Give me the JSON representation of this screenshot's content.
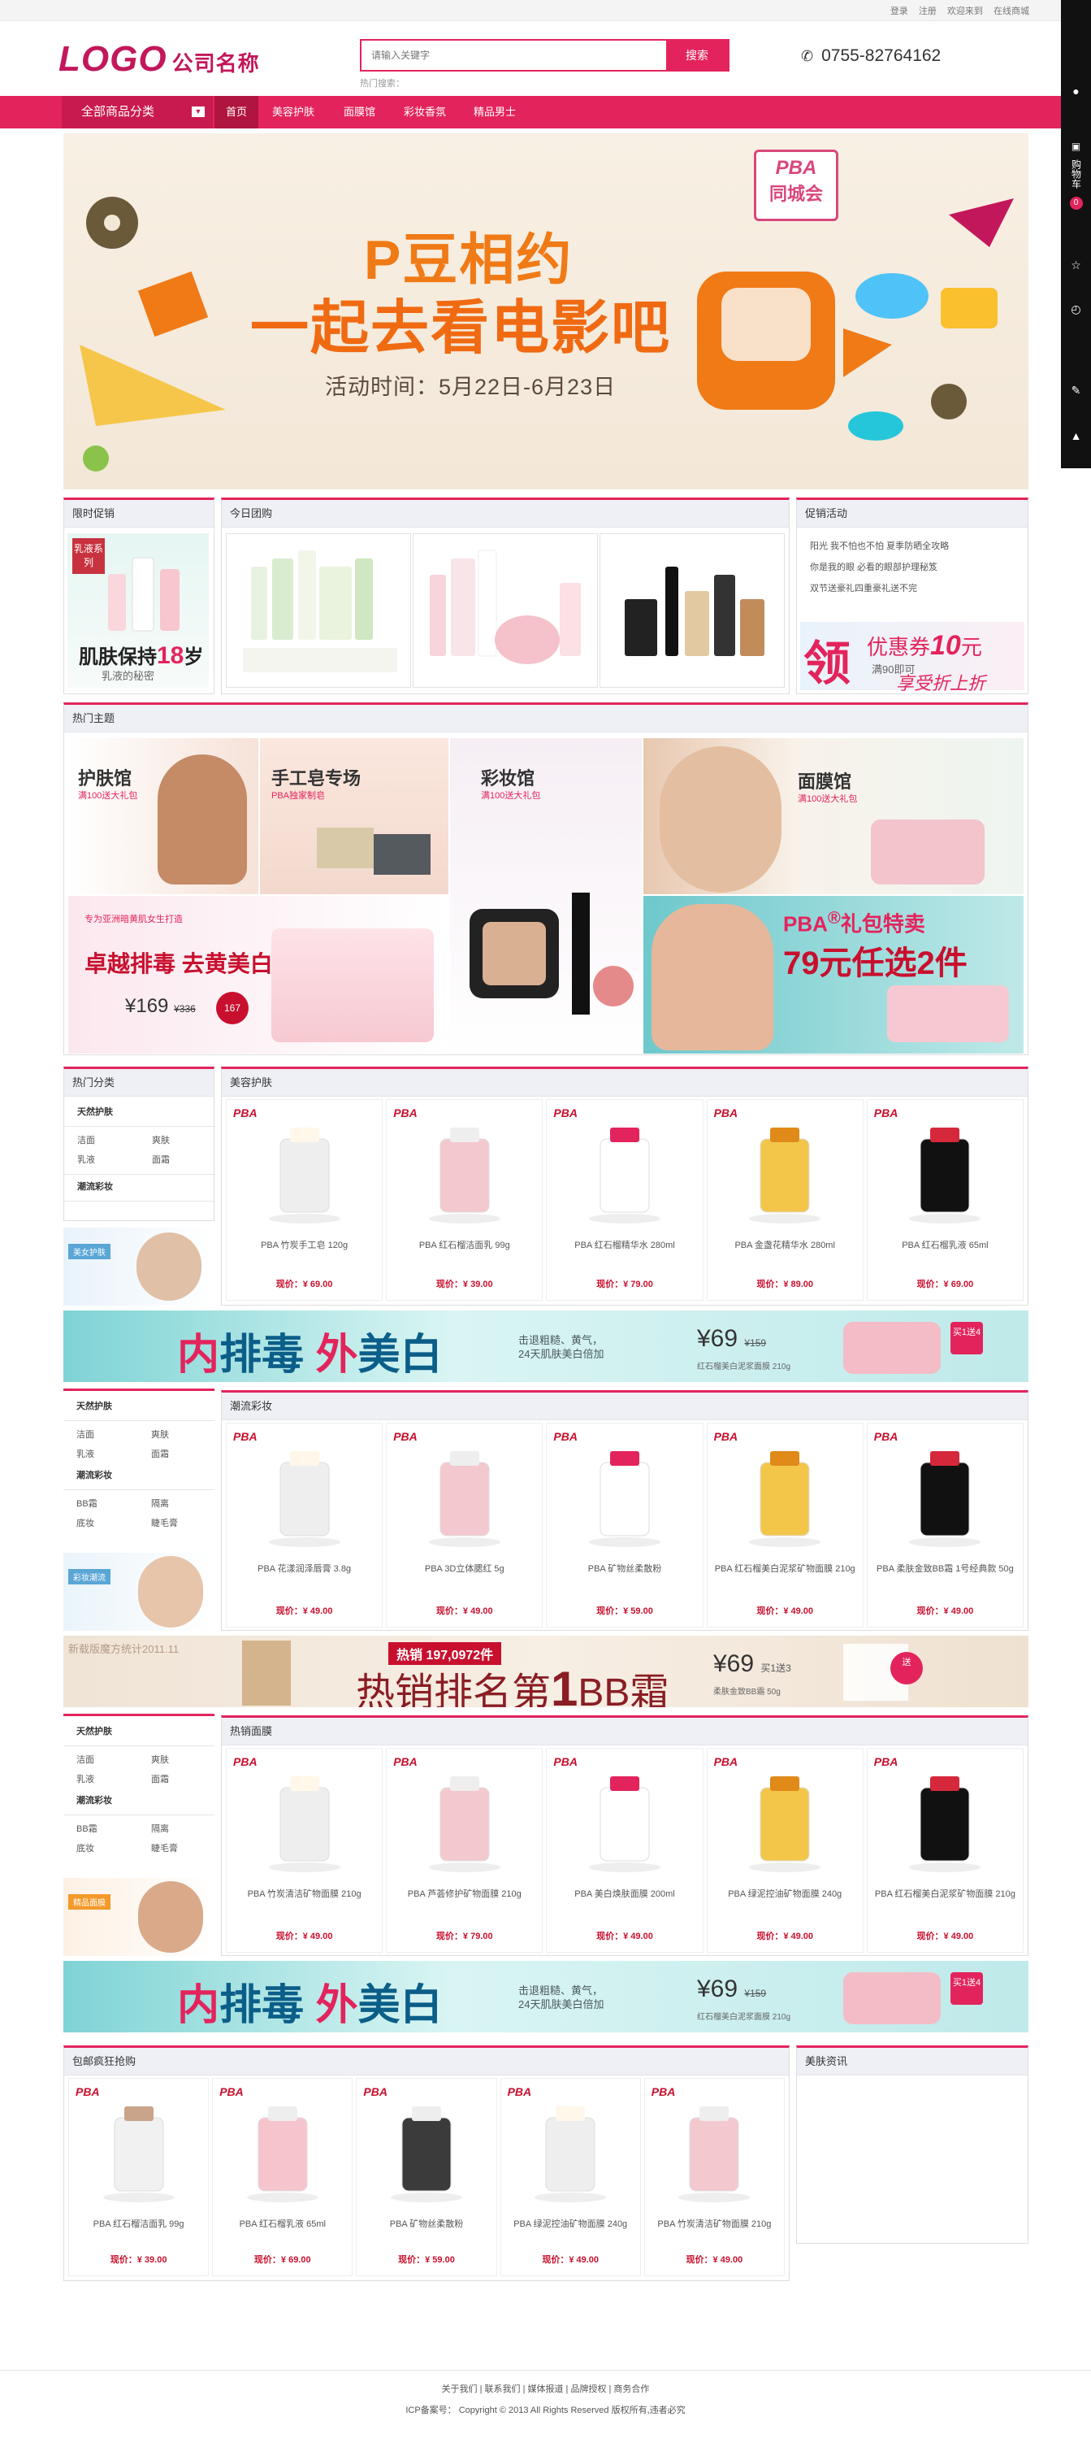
{
  "topbar": {
    "links": [
      "登录",
      "注册",
      "欢迎来到",
      "在线商城"
    ]
  },
  "header": {
    "logo": "LOGO",
    "company": "公司名称",
    "search_placeholder": "请输入关键字",
    "search_button": "搜索",
    "hot_label": "热门搜索：",
    "phone": "0755-82764162"
  },
  "nav": {
    "all_categories": "全部商品分类",
    "items": [
      "首页",
      "美容护肤",
      "面膜馆",
      "彩妆香氛",
      "精品男士"
    ]
  },
  "rightbar": {
    "cart": "购物车",
    "cart_count": "0"
  },
  "banner": {
    "tag1": "PBA",
    "tag2": "同城会",
    "title1": "P豆相约",
    "title2": "一起去看电影吧",
    "date": "活动时间：5月22日-6月23日"
  },
  "row1": {
    "promo_box_title": "限时促销",
    "promo_label": "乳液系列",
    "promo_big_a": "肌肤保持",
    "promo_big_b": "18",
    "promo_big_c": "岁",
    "promo_small": "乳液的秘密",
    "group_title": "今日团购",
    "activity_title": "促销活动",
    "activity_items": [
      "阳光 我不怕也不怕 夏季防晒全攻略",
      "你是我的眼 必看的眼部护理秘笈",
      "双节送豪礼四重豪礼送不完"
    ],
    "coupon_big": "领",
    "coupon_text": "优惠券",
    "coupon_num": "10",
    "coupon_unit": "元",
    "coupon_sub1": "满90即可",
    "coupon_sub2": "享受折上折"
  },
  "hot": {
    "title": "热门主题",
    "t1": "护肤馆",
    "t1s": "满100送大礼包",
    "t2": "手工皂专场",
    "t2s": "PBA独家制皂",
    "t3": "彩妆馆",
    "t3s": "满100送大礼包",
    "t4": "面膜馆",
    "t4s": "满100送大礼包",
    "t5a": "专为亚洲暗黄肌女生打造",
    "t5": "卓越排毒 去黄美白",
    "t5p": "169",
    "t5o": "336",
    "t5b": "167",
    "t6": "PBA",
    "t6b": "礼包特卖",
    "t6c": "79元任选2件"
  },
  "sidecat": {
    "title": "热门分类",
    "g1": "天然护肤",
    "g1rows": [
      [
        "洁面",
        "爽肤"
      ],
      [
        "乳液",
        "面霜"
      ]
    ],
    "g2": "潮流彩妆",
    "g2rows": [
      [
        "BB霜",
        "隔离"
      ],
      [
        "底妆",
        "睫毛膏"
      ]
    ],
    "ad1": "美女护肤",
    "ad2": "彩妆潮流",
    "ad3": "精品面膜"
  },
  "sections": [
    {
      "title": "美容护肤",
      "products": [
        {
          "brand": "PBA",
          "name": "PBA 竹炭手工皂 120g",
          "price": "现价：¥ 69.00"
        },
        {
          "brand": "PBA",
          "name": "PBA 红石榴洁面乳 99g",
          "price": "现价：¥ 39.00"
        },
        {
          "brand": "PBA",
          "name": "PBA 红石榴精华水 280ml",
          "price": "现价：¥ 79.00"
        },
        {
          "brand": "PBA",
          "name": "PBA 金盏花精华水 280ml",
          "price": "现价：¥ 89.00"
        },
        {
          "brand": "PBA",
          "name": "PBA 红石榴乳液 65ml",
          "price": "现价：¥ 69.00"
        }
      ]
    },
    {
      "title": "潮流彩妆",
      "products": [
        {
          "brand": "PBA",
          "name": "PBA 花漾润泽唇膏 3.8g",
          "price": "现价：¥ 49.00"
        },
        {
          "brand": "PBA",
          "name": "PBA 3D立体腮红 5g",
          "price": "现价：¥ 49.00"
        },
        {
          "brand": "PBA",
          "name": "PBA 矿物丝柔散粉",
          "price": "现价：¥ 59.00"
        },
        {
          "brand": "PBA",
          "name": "PBA 红石榴美白泥浆矿物面膜 210g",
          "price": "现价：¥ 49.00"
        },
        {
          "brand": "PBA",
          "name": "PBA 柔肤金致BB霜 1号经典款 50g",
          "price": "现价：¥ 49.00"
        }
      ]
    },
    {
      "title": "热销面膜",
      "products": [
        {
          "brand": "PBA",
          "name": "PBA 竹炭清洁矿物面膜 210g",
          "price": "现价：¥ 49.00"
        },
        {
          "brand": "PBA",
          "name": "PBA 芦荟修护矿物面膜 210g",
          "price": "现价：¥ 79.00"
        },
        {
          "brand": "PBA",
          "name": "PBA 美白焕肤面膜 200ml",
          "price": "现价：¥ 49.00"
        },
        {
          "brand": "PBA",
          "name": "PBA 绿泥控油矿物面膜 240g",
          "price": "现价：¥ 49.00"
        },
        {
          "brand": "PBA",
          "name": "PBA 红石榴美白泥浆矿物面膜 210g",
          "price": "现价：¥ 49.00"
        }
      ]
    }
  ],
  "strip1": {
    "a": "内",
    "b": "排毒",
    "c": "外",
    "d": "美白",
    "m1": "击退粗糙、黄气，",
    "m2": "24天肌肤美白倍加",
    "p": "¥69",
    "o": "¥159",
    "s": "红石榴美白泥浆面膜 210g",
    "buy": "买1送4"
  },
  "strip2": {
    "hot": "热销 197,0972件",
    "main_a": "热销排名第",
    "main_b": "1",
    "main_c": "BB霜",
    "p": "¥69",
    "o": "买1送3",
    "s": "柔肤金致BB霜 50g",
    "buy": "送",
    "watermark": "新载版魔方统计2011.11"
  },
  "free": {
    "title": "包邮疯狂抢购",
    "products": [
      {
        "brand": "PBA",
        "name": "PBA 红石榴洁面乳 99g",
        "price": "现价：¥ 39.00"
      },
      {
        "brand": "PBA",
        "name": "PBA 红石榴乳液 65ml",
        "price": "现价：¥ 69.00"
      },
      {
        "brand": "PBA",
        "name": "PBA 矿物丝柔散粉",
        "price": "现价：¥ 59.00"
      },
      {
        "brand": "PBA",
        "name": "PBA 绿泥控油矿物面膜 240g",
        "price": "现价：¥ 49.00"
      },
      {
        "brand": "PBA",
        "name": "PBA 竹炭清洁矿物面膜 210g",
        "price": "现价：¥ 49.00"
      }
    ],
    "news_title": "美肤资讯"
  },
  "footer": {
    "links": "关于我们 | 联系我们 | 媒体报道 | 品牌授权 | 商务合作",
    "copy": "ICP备案号：  Copyright © 2013 All Rights Reserved    版权所有,违者必究"
  }
}
